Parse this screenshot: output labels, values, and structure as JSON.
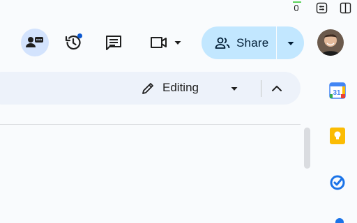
{
  "system": {
    "counter_value": "0"
  },
  "header": {
    "share_label": "Share",
    "icons": {
      "chat": "people-chat-icon",
      "history": "version-history-icon",
      "comments": "comments-icon",
      "meet": "video-camera-icon",
      "share": "people-icon"
    }
  },
  "toolbar": {
    "mode_label": "Editing"
  },
  "side_panel": {
    "apps": [
      "calendar-icon",
      "keep-icon",
      "tasks-icon"
    ],
    "calendar_day": "31"
  },
  "colors": {
    "share_bg": "#c2e7ff",
    "accent": "#0b57d0",
    "toolbar_bg": "#edf2fa",
    "page_bg": "#f9fbfd"
  }
}
